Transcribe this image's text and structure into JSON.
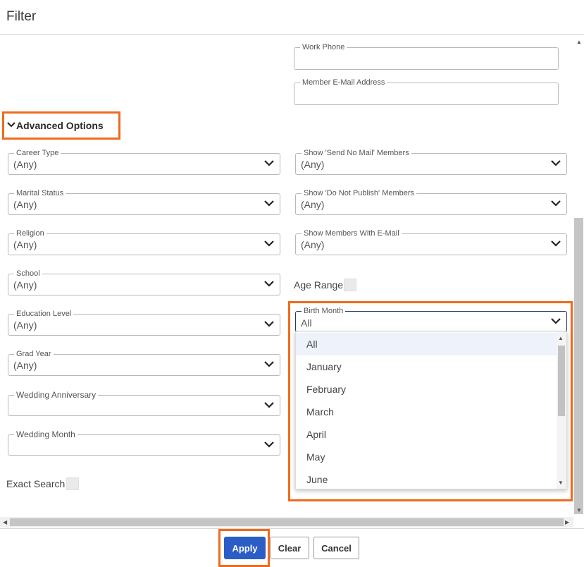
{
  "dialog": {
    "title": "Filter"
  },
  "fields_top": {
    "work_phone": {
      "label": "Work Phone",
      "value": ""
    },
    "member_email": {
      "label": "Member E-Mail Address",
      "value": ""
    }
  },
  "advanced": {
    "label": "Advanced Options"
  },
  "left_selects": [
    {
      "label": "Career Type",
      "value": "(Any)"
    },
    {
      "label": "Marital Status",
      "value": "(Any)"
    },
    {
      "label": "Religion",
      "value": "(Any)"
    },
    {
      "label": "School",
      "value": "(Any)"
    },
    {
      "label": "Education Level",
      "value": "(Any)"
    },
    {
      "label": "Grad Year",
      "value": "(Any)"
    },
    {
      "label": "Wedding Anniversary",
      "value": ""
    },
    {
      "label": "Wedding Month",
      "value": ""
    }
  ],
  "right_selects": [
    {
      "label": "Show 'Send No Mail' Members",
      "value": "(Any)"
    },
    {
      "label": "Show 'Do Not Publish' Members",
      "value": "(Any)"
    },
    {
      "label": "Show Members With E-Mail",
      "value": "(Any)"
    }
  ],
  "age_range": {
    "label": "Age Range"
  },
  "exact_search": {
    "label": "Exact Search"
  },
  "birth_month": {
    "label": "Birth Month",
    "value": "All",
    "options": [
      "All",
      "January",
      "February",
      "March",
      "April",
      "May",
      "June"
    ]
  },
  "footer": {
    "apply": "Apply",
    "clear": "Clear",
    "cancel": "Cancel"
  },
  "colors": {
    "highlight": "#f06a1d",
    "primary": "#2a5dc6"
  }
}
